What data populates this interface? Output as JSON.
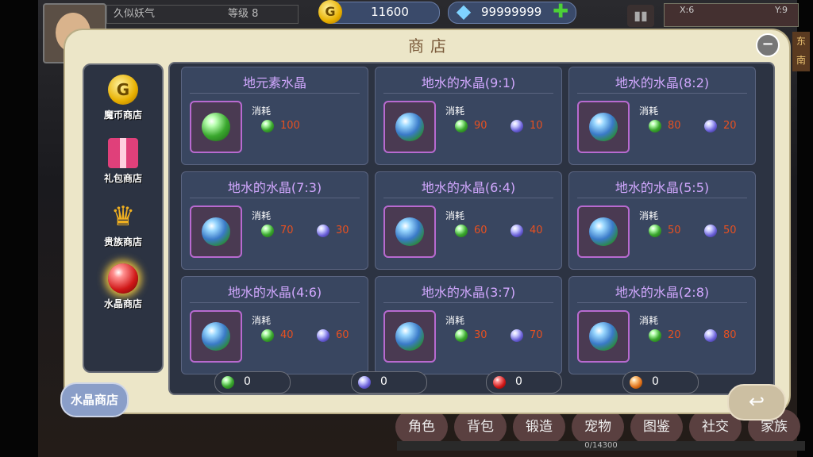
{
  "hud": {
    "player_name": "久似妖气",
    "level_text": "等级 8",
    "gold": "11600",
    "gold_icon_glyph": "G",
    "diamonds": "99999999",
    "add_glyph": "✚",
    "map_x": "X:6",
    "map_y": "Y:9",
    "compass_labels": [
      "东",
      "南"
    ]
  },
  "shop": {
    "title": "商店",
    "close_glyph": "−",
    "sidebar": [
      {
        "label": "魔币商店",
        "icon": "gold-coin-icon"
      },
      {
        "label": "礼包商店",
        "icon": "gift-box-icon"
      },
      {
        "label": "贵族商店",
        "icon": "crown-icon"
      },
      {
        "label": "水晶商店",
        "icon": "red-crystal-icon",
        "selected": true
      }
    ],
    "cost_label": "消耗",
    "items": [
      {
        "name": "地元素水晶",
        "orb": "green",
        "costs": [
          {
            "type": "earth",
            "value": "100"
          }
        ]
      },
      {
        "name": "地水的水晶(9:1)",
        "orb": "mixed",
        "costs": [
          {
            "type": "earth",
            "value": "90"
          },
          {
            "type": "water",
            "value": "10"
          }
        ]
      },
      {
        "name": "地水的水晶(8:2)",
        "orb": "mixed",
        "costs": [
          {
            "type": "earth",
            "value": "80"
          },
          {
            "type": "water",
            "value": "20"
          }
        ]
      },
      {
        "name": "地水的水晶(7:3)",
        "orb": "mixed",
        "costs": [
          {
            "type": "earth",
            "value": "70"
          },
          {
            "type": "water",
            "value": "30"
          }
        ]
      },
      {
        "name": "地水的水晶(6:4)",
        "orb": "mixed",
        "costs": [
          {
            "type": "earth",
            "value": "60"
          },
          {
            "type": "water",
            "value": "40"
          }
        ]
      },
      {
        "name": "地水的水晶(5:5)",
        "orb": "mixed",
        "costs": [
          {
            "type": "earth",
            "value": "50"
          },
          {
            "type": "water",
            "value": "50"
          }
        ]
      },
      {
        "name": "地水的水晶(4:6)",
        "orb": "mixed",
        "costs": [
          {
            "type": "earth",
            "value": "40"
          },
          {
            "type": "water",
            "value": "60"
          }
        ]
      },
      {
        "name": "地水的水晶(3:7)",
        "orb": "mixed",
        "costs": [
          {
            "type": "earth",
            "value": "30"
          },
          {
            "type": "water",
            "value": "70"
          }
        ]
      },
      {
        "name": "地水的水晶(2:8)",
        "orb": "mixed",
        "costs": [
          {
            "type": "earth",
            "value": "20"
          },
          {
            "type": "water",
            "value": "80"
          }
        ]
      }
    ],
    "resources": [
      {
        "type": "earth",
        "value": "0"
      },
      {
        "type": "water",
        "value": "0"
      },
      {
        "type": "fire",
        "value": "0"
      },
      {
        "type": "wind",
        "value": "0"
      }
    ],
    "tab_badge": "水晶商店",
    "back_glyph": "↩"
  },
  "bottom_menu": {
    "items": [
      "角色",
      "背包",
      "锻造",
      "宠物",
      "图鉴",
      "社交",
      "家族"
    ],
    "exp_text": "0/14300"
  },
  "colors": {
    "panel_bg": "#ece6c8",
    "card_bg": "#394660",
    "title_purple": "#d2a8ff",
    "cost_red": "#e85020"
  }
}
